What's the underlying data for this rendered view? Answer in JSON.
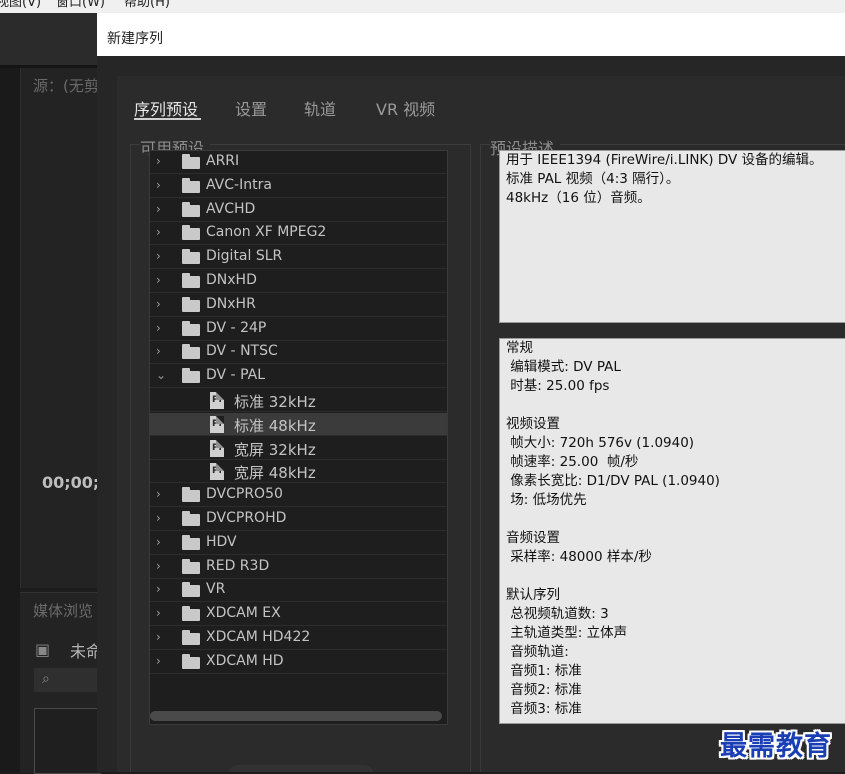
{
  "menubar": {
    "items": [
      "视图(V)",
      "窗口(W)",
      "帮助(H)"
    ]
  },
  "background": {
    "source_label": "源：(无剪",
    "timecode": "00;00;0",
    "media_label": "媒体浏览",
    "untitled": "未命"
  },
  "dialog": {
    "title": "新建序列",
    "tabs": [
      "序列预设",
      "设置",
      "轨道",
      "VR 视频"
    ],
    "active_tab": "序列预设",
    "available_presets_label": "可用预设",
    "preset_description_label": "预设描述",
    "presets": [
      {
        "label": "ARRI",
        "type": "folder",
        "expanded": false
      },
      {
        "label": "AVC-Intra",
        "type": "folder",
        "expanded": false
      },
      {
        "label": "AVCHD",
        "type": "folder",
        "expanded": false
      },
      {
        "label": "Canon XF MPEG2",
        "type": "folder",
        "expanded": false
      },
      {
        "label": "Digital SLR",
        "type": "folder",
        "expanded": false
      },
      {
        "label": "DNxHD",
        "type": "folder",
        "expanded": false
      },
      {
        "label": "DNxHR",
        "type": "folder",
        "expanded": false
      },
      {
        "label": "DV - 24P",
        "type": "folder",
        "expanded": false
      },
      {
        "label": "DV - NTSC",
        "type": "folder",
        "expanded": false
      },
      {
        "label": "DV - PAL",
        "type": "folder",
        "expanded": true
      },
      {
        "label": "标准 32kHz",
        "type": "preset",
        "selected": false
      },
      {
        "label": "标准 48kHz",
        "type": "preset",
        "selected": true
      },
      {
        "label": "宽屏 32kHz",
        "type": "preset",
        "selected": false
      },
      {
        "label": "宽屏 48kHz",
        "type": "preset",
        "selected": false
      },
      {
        "label": "DVCPRO50",
        "type": "folder",
        "expanded": false
      },
      {
        "label": "DVCPROHD",
        "type": "folder",
        "expanded": false
      },
      {
        "label": "HDV",
        "type": "folder",
        "expanded": false
      },
      {
        "label": "RED R3D",
        "type": "folder",
        "expanded": false
      },
      {
        "label": "VR",
        "type": "folder",
        "expanded": false
      },
      {
        "label": "XDCAM EX",
        "type": "folder",
        "expanded": false
      },
      {
        "label": "XDCAM HD422",
        "type": "folder",
        "expanded": false
      },
      {
        "label": "XDCAM HD",
        "type": "folder",
        "expanded": false
      }
    ],
    "description": [
      "用于 IEEE1394 (FireWire/i.LINK) DV 设备的编辑。",
      "标准 PAL 视频（4:3 隔行）。",
      "48kHz（16 位）音频。"
    ],
    "details": [
      "常规",
      " 编辑模式: DV PAL",
      " 时基: 25.00 fps",
      "",
      "视频设置",
      " 帧大小: 720h 576v (1.0940)",
      " 帧速率: 25.00  帧/秒",
      " 像素长宽比: D1/DV PAL (1.0940)",
      " 场: 低场优先",
      "",
      "音频设置",
      " 采样率: 48000 样本/秒",
      "",
      "默认序列",
      " 总视频轨道数: 3",
      " 主轨道类型: 立体声",
      " 音频轨道:",
      " 音频1: 标准",
      " 音频2: 标准",
      " 音频3: 标准"
    ]
  },
  "watermark": "最需教育",
  "colors": {
    "dialog_bg": "#262626",
    "tree_bg": "#1e1e1e",
    "selected_row": "#3b3b3b",
    "description_bg": "#e8e8e8",
    "watermark": "#1a3fb5"
  }
}
